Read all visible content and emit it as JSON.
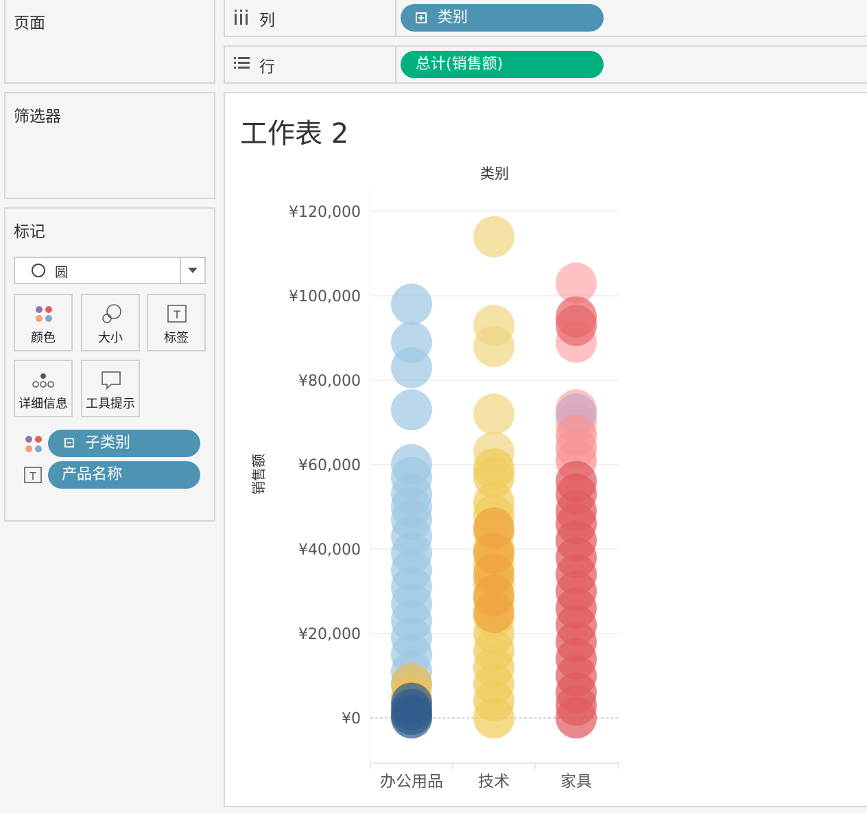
{
  "left": {
    "pages_title": "页面",
    "filters_title": "筛选器",
    "marks_title": "标记",
    "mark_type": "圆",
    "buttons": {
      "color": "颜色",
      "size": "大小",
      "label": "标签",
      "detail": "详细信息",
      "tooltip": "工具提示"
    },
    "mark_fields": [
      {
        "name": "子类别",
        "role": "color"
      },
      {
        "name": "产品名称",
        "role": "label"
      }
    ]
  },
  "shelves": {
    "columns_label": "列",
    "columns_pill": "类别",
    "rows_label": "行",
    "rows_pill": "总计(销售额)"
  },
  "sheet": {
    "title": "工作表 2"
  },
  "chart_data": {
    "type": "scatter",
    "title": "",
    "header": "类别",
    "xlabel": "",
    "ylabel": "销售额",
    "categories": [
      "办公用品",
      "技术",
      "家具"
    ],
    "y_ticks": [
      {
        "v": 0,
        "label": "¥0"
      },
      {
        "v": 20000,
        "label": "¥20,000"
      },
      {
        "v": 40000,
        "label": "¥40,000"
      },
      {
        "v": 60000,
        "label": "¥60,000"
      },
      {
        "v": 80000,
        "label": "¥80,000"
      },
      {
        "v": 100000,
        "label": "¥100,000"
      },
      {
        "v": 120000,
        "label": "¥120,000"
      }
    ],
    "ylim": [
      -10000,
      125000
    ],
    "grid": true,
    "series": [
      {
        "category": "办公用品",
        "color": "#a0c8e3",
        "values": [
          98000,
          89000,
          83000,
          73000,
          60000,
          57000,
          53000,
          50000,
          47000,
          43000,
          39000,
          35000,
          31000,
          27000,
          23000,
          19000,
          15000,
          11000,
          8000
        ]
      },
      {
        "category": "办公用品",
        "color": "#f0bf55",
        "values": [
          8000,
          5000
        ]
      },
      {
        "category": "办公用品",
        "color": "#2f5d8c",
        "values": [
          3500,
          2000,
          800,
          0
        ]
      },
      {
        "category": "技术",
        "color": "#eed584",
        "values": [
          114000,
          93000,
          88000,
          72000,
          63000
        ]
      },
      {
        "category": "技术",
        "color": "#f0cc5c",
        "values": [
          59000,
          57000,
          51000,
          48000,
          44000,
          40000,
          36000,
          32000,
          28000,
          24000,
          20000,
          16000,
          12000,
          8000,
          4000,
          0
        ]
      },
      {
        "category": "技术",
        "color": "#f0a340",
        "values": [
          45000,
          39000,
          34000,
          29000,
          25000
        ]
      },
      {
        "category": "家具",
        "color": "#ffaaad",
        "values": [
          103000,
          89000,
          73000,
          70000
        ]
      },
      {
        "category": "家具",
        "color": "#e8686b",
        "values": [
          95000,
          93000
        ]
      },
      {
        "category": "家具",
        "color": "#c9a8c8",
        "values": [
          72000
        ]
      },
      {
        "category": "家具",
        "color": "#f79595",
        "values": [
          67000,
          64000,
          61000
        ]
      },
      {
        "category": "家具",
        "color": "#e05c5e",
        "values": [
          56000,
          53000,
          49000,
          46000,
          42000,
          38000,
          34000,
          30000,
          26000,
          22000,
          18000,
          14000,
          10000,
          6000,
          3000,
          0
        ]
      }
    ]
  },
  "colors": {
    "pill_blue": "#4d93b2",
    "pill_green": "#00b17f",
    "legend_dots": [
      "#8b7aa8",
      "#e05c5e",
      "#f0a374",
      "#7fa6d6"
    ]
  }
}
